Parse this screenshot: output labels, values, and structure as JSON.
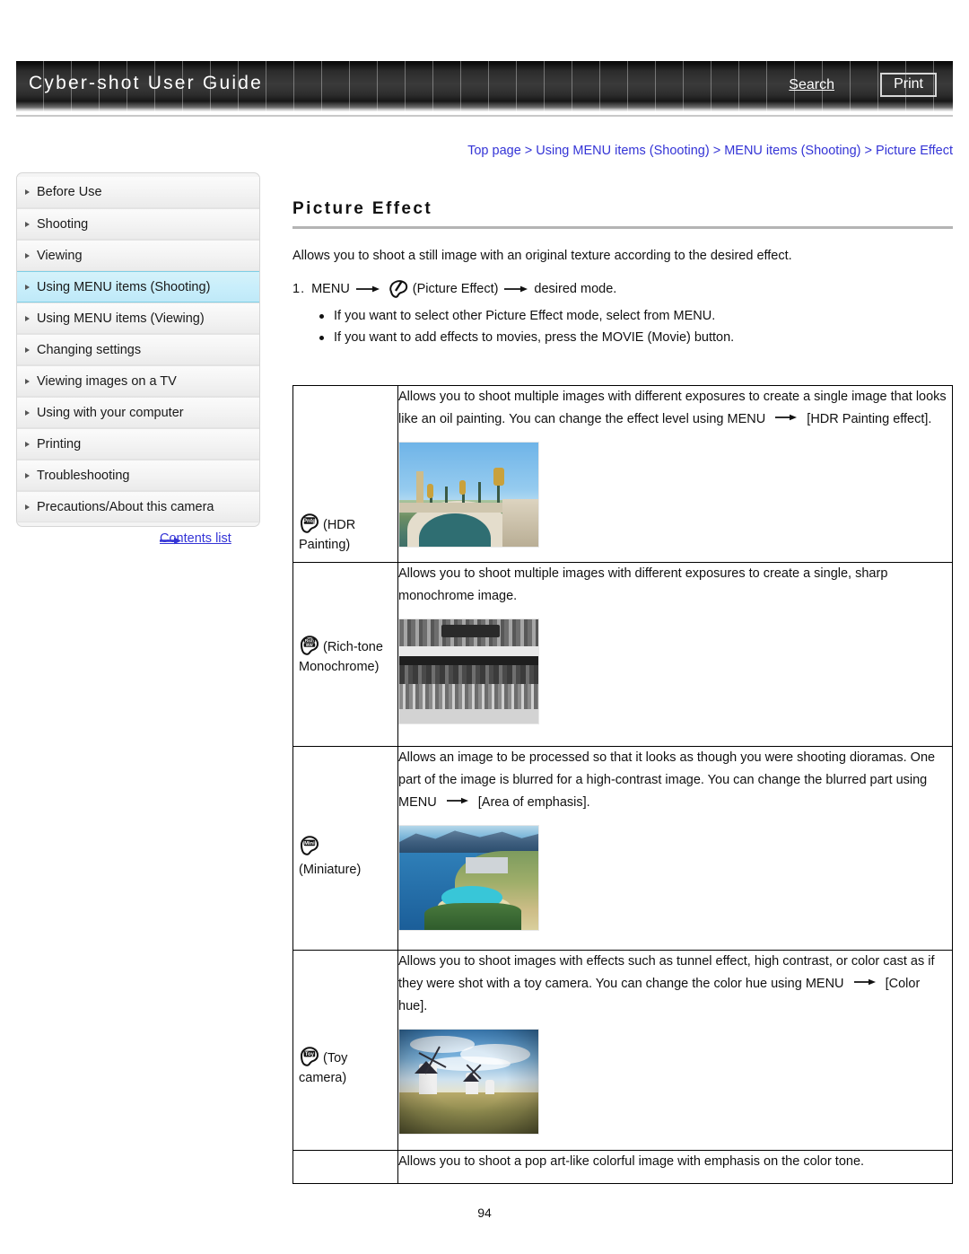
{
  "header": {
    "site_title": "Cyber-shot User Guide",
    "search_label": "Search",
    "print_label": "Print"
  },
  "breadcrumb": {
    "text": "Top page > Using MENU items (Shooting) > MENU items (Shooting) > Picture Effect"
  },
  "sidebar": {
    "items": [
      {
        "label": "Before Use",
        "selected": false
      },
      {
        "label": "Shooting",
        "selected": false
      },
      {
        "label": "Viewing",
        "selected": false
      },
      {
        "label": "Using MENU items (Shooting)",
        "selected": true
      },
      {
        "label": "Using MENU items (Viewing)",
        "selected": false
      },
      {
        "label": "Changing settings",
        "selected": false
      },
      {
        "label": "Viewing images on a TV",
        "selected": false
      },
      {
        "label": "Using with your computer",
        "selected": false
      },
      {
        "label": "Printing",
        "selected": false
      },
      {
        "label": "Troubleshooting",
        "selected": false
      },
      {
        "label": "Precautions/About this camera",
        "selected": false
      }
    ],
    "contents_link": "Contents list"
  },
  "main": {
    "title": "Picture Effect",
    "intro": "Allows you to shoot a still image with an original texture according to the desired effect.",
    "step": {
      "number": "1.",
      "part1": "MENU",
      "icon_name": "picture-effect-icon",
      "part2": "(Picture Effect)",
      "part3": "desired mode."
    },
    "bullets": [
      "If you want to select other Picture Effect mode, select from MENU.",
      "If you want to add effects to movies, press the MOVIE (Movie) button."
    ]
  },
  "table": {
    "rows": [
      {
        "icon_badge": "Pntg",
        "icon_name": "hdr-painting-badge-icon",
        "label": "(HDR Painting)",
        "description_lines": [
          "Allows you to shoot multiple images with different exposures to create a single image",
          "that looks like an oil painting. You can change the effect level using MENU",
          "[HDR Painting effect]."
        ],
        "description_full": "Allows you to shoot multiple images with different exposures to create a single image that looks like an oil painting. You can change the effect level using MENU → [HDR Painting effect].",
        "photo_name": "bridge-photo",
        "photo_alt": "Ornate stone bridge over a river under blue sky"
      },
      {
        "icon_badge": "Rich BW",
        "icon_name": "rich-tone-monochrome-badge-icon",
        "label": "(Rich-tone Monochrome)",
        "description_lines": [
          "Allows you to shoot multiple images with different exposures to create a single, sharp",
          "monochrome image."
        ],
        "description_full": "Allows you to shoot multiple images with different exposures to create a single, sharp monochrome image.",
        "photo_name": "monochrome-storefront-photo",
        "photo_alt": "Black and white photo of a café storefront with crowd"
      },
      {
        "icon_badge": "Mini",
        "icon_name": "miniature-badge-icon",
        "label": "(Miniature)",
        "description_lines": [
          "Allows an image to be processed so that it looks as though you were shooting",
          "dioramas. One part of the image is blurred for a high-contrast image. You can change",
          "the blurred part using MENU",
          "[Area of emphasis]."
        ],
        "description_full": "Allows an image to be processed so that it looks as though you were shooting dioramas. One part of the image is blurred for a high-contrast image. You can change the blurred part using MENU → [Area of emphasis].",
        "photo_name": "coastline-photo",
        "photo_alt": "Aerial view of a tropical coastline with a bay and beach"
      },
      {
        "icon_badge": "Toy",
        "icon_name": "toy-camera-badge-icon",
        "label": "(Toy camera)",
        "description_lines": [
          "Allows you to shoot images with effects such as tunnel effect, high contrast, or color",
          "cast as if they were shot with a toy camera. You can change the color hue using",
          "MENU",
          "[Color hue]."
        ],
        "description_full": "Allows you to shoot images with effects such as tunnel effect, high contrast, or color cast as if they were shot with a toy camera. You can change the color hue using MENU → [Color hue].",
        "photo_name": "windmills-photo",
        "photo_alt": "Windmills on a hill with vignetted sky"
      },
      {
        "icon_badge": "",
        "icon_name": "pop-color-badge-icon",
        "label": "",
        "description_lines": [
          "Allows you to shoot a pop art-like colorful image with emphasis on the color tone."
        ],
        "description_full": "Allows you to shoot a pop art-like colorful image with emphasis on the color tone.",
        "photo_name": "",
        "photo_alt": ""
      }
    ]
  },
  "footer": {
    "page_number": "94"
  },
  "colors": {
    "link": "#3434d6",
    "selected_nav": "#c8eefb",
    "header_dark": "#2c2c2c"
  }
}
